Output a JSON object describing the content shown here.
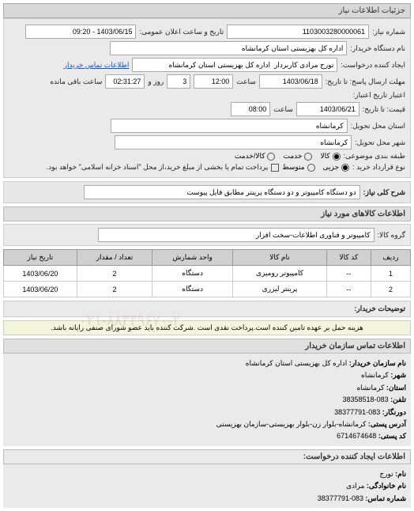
{
  "sections": {
    "details_title": "جزئیات اطلاعات نیاز",
    "items_title": "اطلاعات کالاهای مورد نیاز",
    "contact_title": "اطلاعات تماس سازمان خریدار",
    "requester_title": "اطلاعات ایجاد کننده درخواست:"
  },
  "form": {
    "need_number_label": "شماره نیاز:",
    "need_number": "1103003280000061",
    "public_date_label": "تاریخ و ساعت اعلان عمومی:",
    "public_date": "1403/06/15 - 09:20",
    "buyer_org_label": "نام دستگاه خریدار:",
    "buyer_org": "اداره کل بهزیستی استان کرمانشاه",
    "requester_label": "ایجاد کننده درخواست:",
    "requester": "تورج مرادی کاربردار  اداره کل بهزیستی استان کرمانشاه",
    "contact_link": "اطلاعات تماس خریدار",
    "deadline_label": "مهلت ارسال پاسخ: تا تاریخ:",
    "deadline_date": "1403/06/18",
    "time_label": "ساعت",
    "deadline_time": "12:00",
    "days_count": "3",
    "days_label": "روز و",
    "remaining_time": "02:31:27",
    "remaining_label": "ساعت باقی مانده",
    "valid_label": "اعتبار تاریخ اعتبار:",
    "valid2_label": "قیمت: تا تاریخ:",
    "valid_date": "1403/06/21",
    "valid_time": "08:00",
    "province_label": "استان محل تحویل:",
    "province": "کرمانشاه",
    "city_label": "شهر محل تحویل:",
    "city": "کرمانشاه",
    "topic_type_label": "طبقه بندی موضوعی:",
    "topic_goods": "کالا",
    "topic_service": "خدمت",
    "topic_mixed": "کالا/خدمت",
    "contract_type_label": "نوع قرارداد خرید :",
    "contract_partial": "جزیی",
    "contract_medium": "متوسط",
    "contract_note": "پرداخت تمام یا بخشی از مبلغ خرید،از محل \"اسناد خزانه اسلامی\" خواهد بود.",
    "summary_label": "شرح کلی نیاز:",
    "summary": "دو دستگاه کامپیوتر و دو دستگاه پرینتر مطابق فایل پیوست",
    "group_label": "گروه کالا:",
    "group": "کامپیوتر و فناوری اطلاعات-سخت افزار",
    "buyer_notes_label": "توضیحات خریدار:",
    "buyer_notes": "هزینه حمل بر عهده تامین کننده است.پرداخت نقدی است .شرکت کننده باید عضو شورای صنفی رایانه باشد."
  },
  "table": {
    "headers": {
      "row": "ردیف",
      "code": "کد کالا",
      "name": "نام کالا",
      "unit": "واحد شمارش",
      "qty": "تعداد / مقدار",
      "date": "تاریخ نیاز"
    },
    "rows": [
      {
        "row": "1",
        "code": "--",
        "name": "کامپیوتر رومیزی",
        "unit": "دستگاه",
        "qty": "2",
        "date": "1403/06/20"
      },
      {
        "row": "2",
        "code": "--",
        "name": "پرینتر لیزری",
        "unit": "دستگاه",
        "qty": "2",
        "date": "1403/06/20"
      }
    ]
  },
  "contact": {
    "org_label": "نام سازمان خریدار:",
    "org": "اداره کل بهزیستی استان کرمانشاه",
    "province_label": "شهر:",
    "province": "کرمانشاه",
    "city_label": "استان:",
    "city": "کرمانشاه",
    "phone_label": "تلفن:",
    "phone": "083-38358518",
    "fax_label": "دورنگار:",
    "fax": "083-38377791",
    "address_label": "آدرس پستی:",
    "address": "کرمانشاه-بلوار زن-بلوار بهزیستی-سازمان بهزیستی",
    "postal_label": "کد پستی:",
    "postal": "6714674648"
  },
  "requester": {
    "name_label": "نام:",
    "name": "تورج",
    "family_label": "نام خانوادگی:",
    "family": "مرادی",
    "phone_label": "شماره تماس:",
    "phone": "083-38377791"
  },
  "watermark": "۰۲۱-۸۸۳۴۹۶۷۰-۲"
}
